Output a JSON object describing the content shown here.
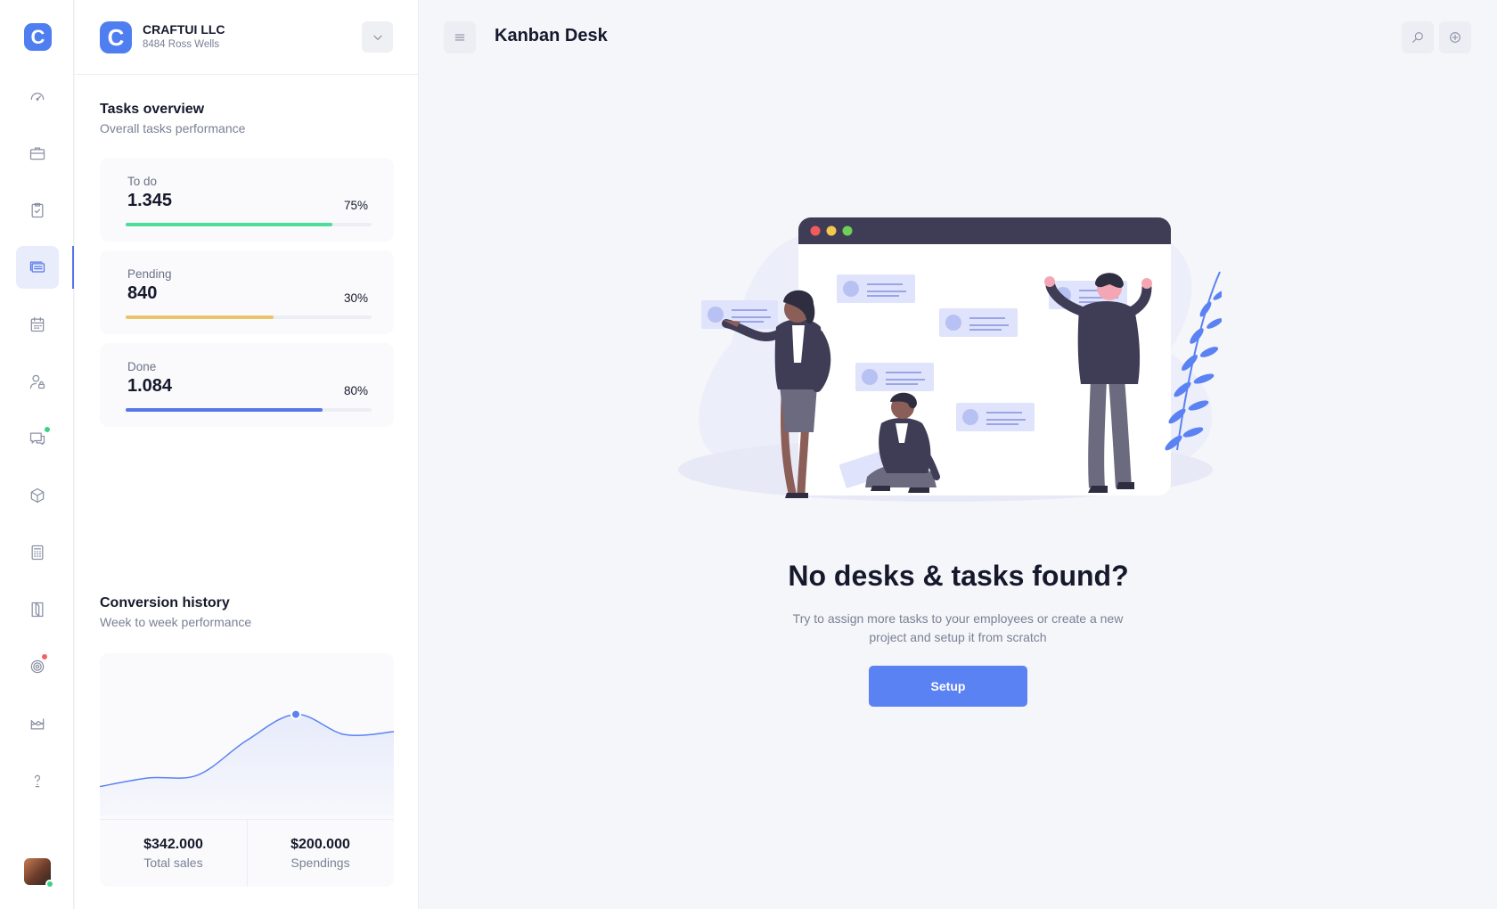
{
  "rail": {
    "logo_letter": "C",
    "items": [
      {
        "name": "dashboard",
        "icon": "speedometer-icon"
      },
      {
        "name": "projects",
        "icon": "briefcase-icon"
      },
      {
        "name": "tasks",
        "icon": "clipboard-check-icon"
      },
      {
        "name": "kanban",
        "icon": "stacked-boards-icon",
        "active": true
      },
      {
        "name": "calendar",
        "icon": "calendar-icon"
      },
      {
        "name": "users",
        "icon": "user-lock-icon"
      },
      {
        "name": "messages",
        "icon": "chat-icon",
        "badge_color": "#3fd087"
      },
      {
        "name": "products",
        "icon": "box-icon"
      },
      {
        "name": "calculator",
        "icon": "calculator-icon"
      },
      {
        "name": "documents",
        "icon": "book-icon"
      },
      {
        "name": "goals",
        "icon": "target-icon",
        "badge_color": "#f2645f"
      },
      {
        "name": "reports",
        "icon": "area-chart-icon"
      },
      {
        "name": "help",
        "icon": "question-icon"
      }
    ]
  },
  "company": {
    "logo_letter": "C",
    "name": "CRAFTUI LLC",
    "address": "8484 Ross Wells"
  },
  "tasks_overview": {
    "title": "Tasks overview",
    "subtitle": "Overall tasks performance",
    "cards": [
      {
        "label": "To do",
        "value": "1.345",
        "percent_label": "75%",
        "progress": 0.84,
        "color": "#4ddc9a"
      },
      {
        "label": "Pending",
        "value": "840",
        "percent_label": "30%",
        "progress": 0.6,
        "color": "#e9c46a"
      },
      {
        "label": "Done",
        "value": "1.084",
        "percent_label": "80%",
        "progress": 0.8,
        "color": "#5676ea"
      }
    ]
  },
  "conversion": {
    "title": "Conversion history",
    "subtitle": "Week to week performance",
    "total_sales_value": "$342.000",
    "total_sales_label": "Total sales",
    "spendings_value": "$200.000",
    "spendings_label": "Spendings",
    "line_color": "#5b82f3"
  },
  "chart_data": {
    "type": "area",
    "title": "",
    "xlabel": "",
    "ylabel": "",
    "grid": false,
    "legend": "none",
    "x": [
      0,
      1,
      2,
      3,
      4,
      5,
      6
    ],
    "series": [
      {
        "values": [
          20,
          26,
          28,
          52,
          70,
          56,
          58
        ]
      }
    ],
    "ylim": [
      0,
      100
    ],
    "highlight_index": 4
  },
  "main": {
    "title": "Kanban Desk",
    "empty_title": "No desks & tasks found?",
    "empty_description": "Try to assign more tasks to your employees or create a new project and setup it from scratch",
    "setup_label": "Setup"
  },
  "colors": {
    "accent": "#5b82f3",
    "brand": "#4e7ef0"
  }
}
